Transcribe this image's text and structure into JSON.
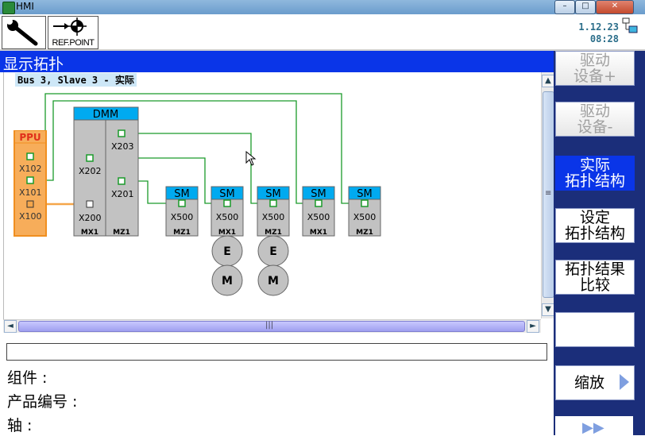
{
  "window": {
    "title": "HMI",
    "minimize": "–",
    "maximize": "□",
    "close": "✕"
  },
  "toolbar": {
    "settings_icon": "wrench-icon",
    "refpoint_icon": "reference-point-icon",
    "refpoint_label": "REF.POINT",
    "version": "1.12.23",
    "time": "08:28",
    "network_icon": "network-status-icon"
  },
  "screen": {
    "title": "显示拓扑",
    "bus_label": "Bus 3, Slave 3 - 实际"
  },
  "topology": {
    "ppu": {
      "name": "PPU",
      "ports": [
        "X102",
        "X101",
        "X100"
      ]
    },
    "dmm": {
      "name": "DMM",
      "ports": [
        "X203",
        "X202",
        "X201",
        "X200"
      ],
      "bottom": [
        "MX1",
        "MZ1"
      ]
    },
    "sm_modules": [
      {
        "name": "SM",
        "port": "X500",
        "bottom": "MZ1"
      },
      {
        "name": "SM",
        "port": "X500",
        "bottom": "MX1"
      },
      {
        "name": "SM",
        "port": "X500",
        "bottom": "MZ1"
      },
      {
        "name": "SM",
        "port": "X500",
        "bottom": "MX1"
      },
      {
        "name": "SM",
        "port": "X500",
        "bottom": "MZ1"
      }
    ],
    "encoder_label": "E",
    "motor_label": "M",
    "colors": {
      "drive_cliq": "#1a9a2a",
      "ppu": "#f5a64a",
      "header": "#00aaf0",
      "module": "#c2c2c2"
    }
  },
  "details": {
    "component_label": "组件 :",
    "product_no_label": "产品编号 :",
    "axis_label": "轴 :"
  },
  "softkeys": [
    {
      "label": "驱动\n设备+",
      "state": "disabled"
    },
    {
      "label": "驱动\n设备-",
      "state": "disabled"
    },
    {
      "label": "实际\n拓扑结构",
      "state": "active"
    },
    {
      "label": "设定\n拓扑结构",
      "state": "normal"
    },
    {
      "label": "拓扑结果\n比较",
      "state": "normal"
    },
    {
      "label": "",
      "state": "normal"
    },
    {
      "label": "缩放",
      "state": "normal"
    }
  ],
  "scroll_icons": {
    "up": "▲",
    "down": "▼",
    "left": "◄",
    "right": "►",
    "grip_v": "≡",
    "grip_h": "|||"
  },
  "more_icon": "▶▶"
}
